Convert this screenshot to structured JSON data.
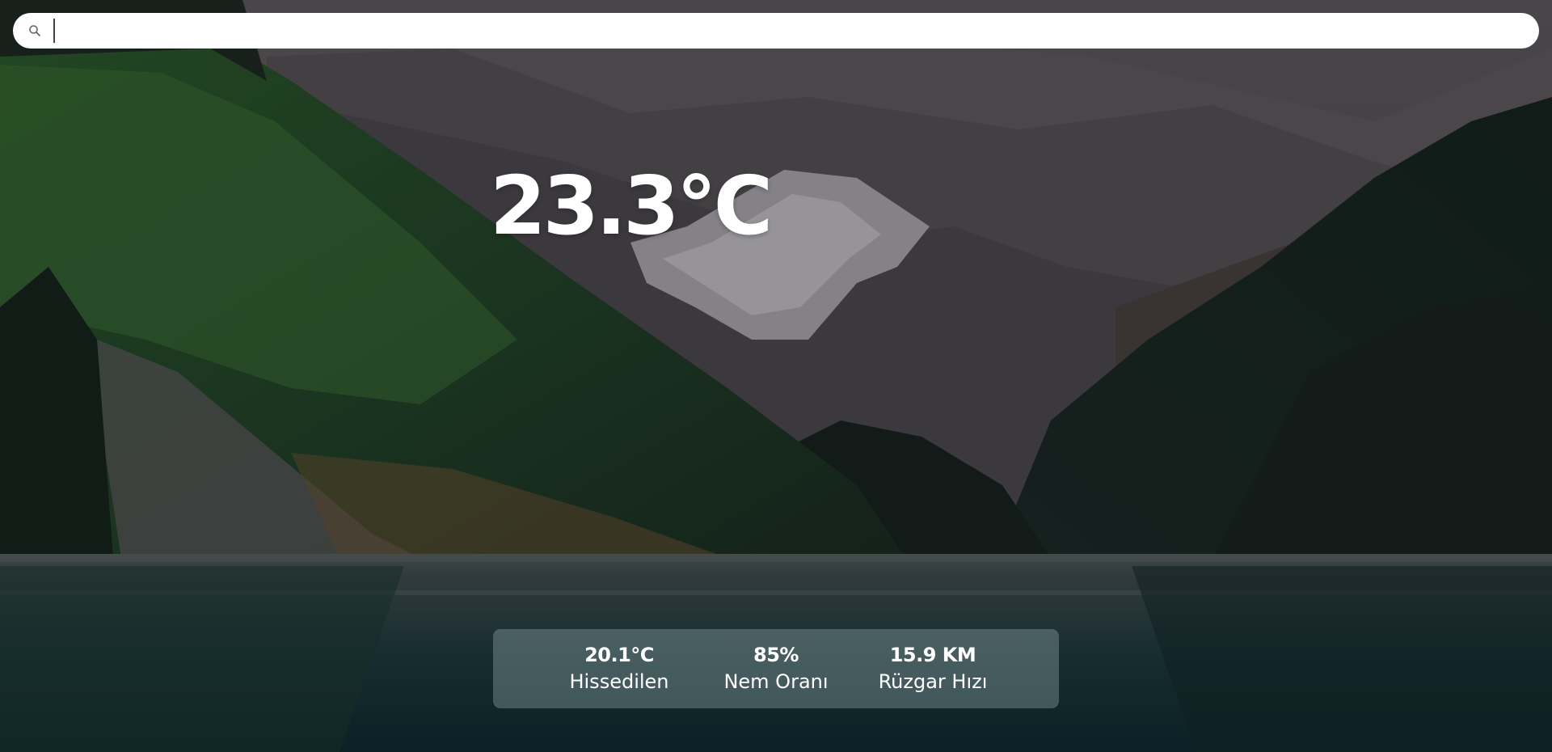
{
  "search": {
    "value": "",
    "placeholder": ""
  },
  "weather": {
    "temperature": "23.3°C"
  },
  "details": [
    {
      "value": "20.1°C",
      "label": "Hissedilen"
    },
    {
      "value": "85%",
      "label": "Nem Oranı"
    },
    {
      "value": "15.9 KM",
      "label": "Rüzgar Hızı"
    }
  ],
  "icons": {
    "search": "search-icon"
  }
}
